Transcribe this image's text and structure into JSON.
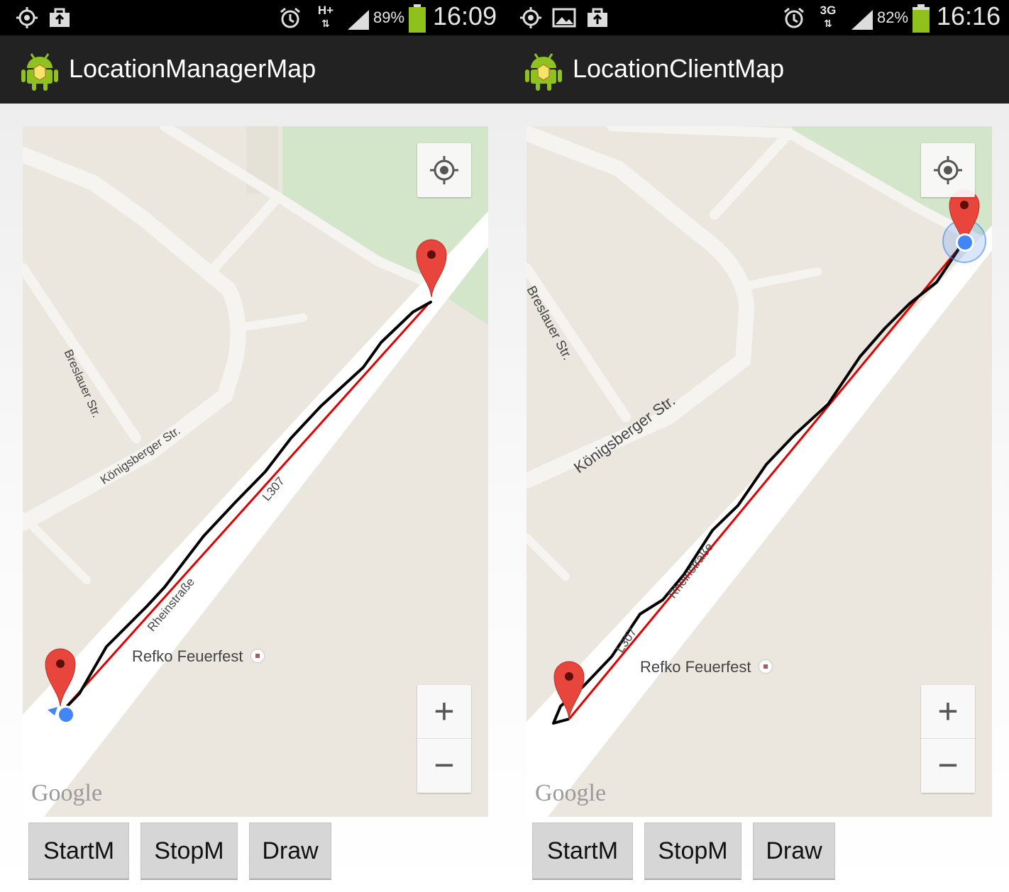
{
  "left": {
    "status": {
      "battery": "89%",
      "time": "16:09",
      "network": "H+"
    },
    "app_title": "LocationManagerMap",
    "map": {
      "streets": [
        "Breslauer Str.",
        "Königsberger Str.",
        "L307",
        "Rheinstraße"
      ],
      "poi": "Refko Feuerfest",
      "zoom_in": "+",
      "zoom_out": "−",
      "attribution": "Google"
    },
    "buttons": [
      "StartM",
      "StopM",
      "Draw"
    ]
  },
  "right": {
    "status": {
      "battery": "82%",
      "time": "16:16",
      "network": "3G"
    },
    "app_title": "LocationClientMap",
    "map": {
      "streets": [
        "Breslauer Str.",
        "Königsberger Str.",
        "L307",
        "Rheinstraße"
      ],
      "poi": "Refko Feuerfest",
      "zoom_in": "+",
      "zoom_out": "−",
      "attribution": "Google"
    },
    "buttons": [
      "StartM",
      "StopM",
      "Draw"
    ]
  },
  "colors": {
    "straight_line": "#e00000",
    "track": "#000000",
    "marker": "#e8453c",
    "my_location": "#4285f4",
    "park": "#d3e6c9"
  }
}
